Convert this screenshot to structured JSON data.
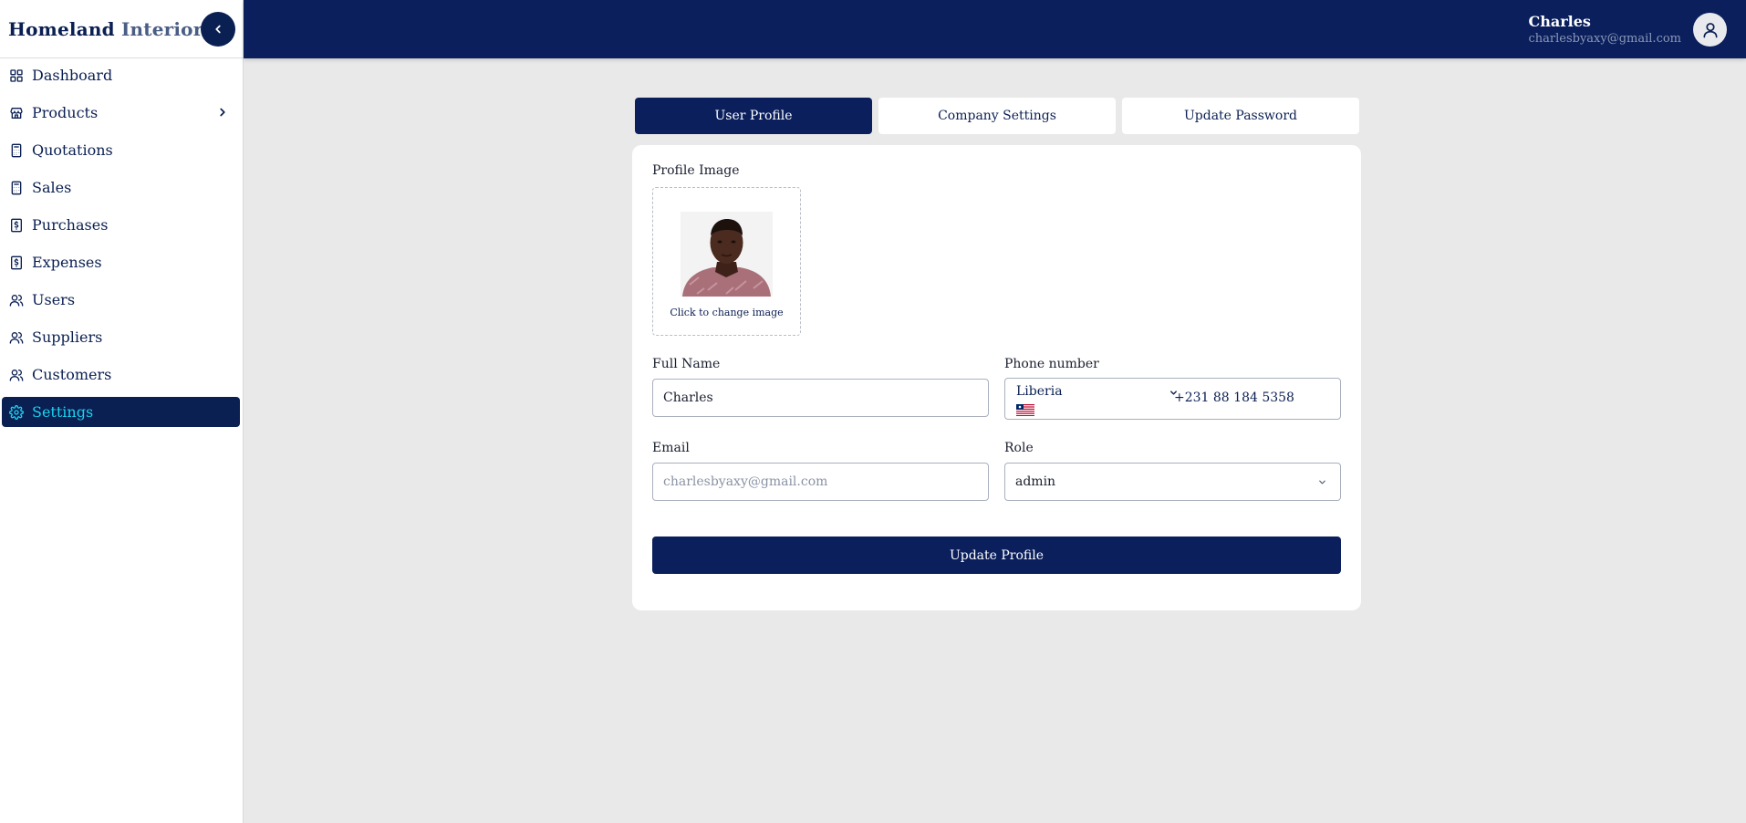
{
  "brand": {
    "name_part1": "Homeland",
    "name_part2": "Interiors"
  },
  "sidebar": {
    "items": [
      {
        "label": "Dashboard",
        "icon": "grid-icon"
      },
      {
        "label": "Products",
        "icon": "store-icon"
      },
      {
        "label": "Quotations",
        "icon": "calculator-icon"
      },
      {
        "label": "Sales",
        "icon": "calculator-icon"
      },
      {
        "label": "Purchases",
        "icon": "dollar-receipt-icon"
      },
      {
        "label": "Expenses",
        "icon": "dollar-receipt-icon"
      },
      {
        "label": "Users",
        "icon": "users-icon"
      },
      {
        "label": "Suppliers",
        "icon": "users-icon"
      },
      {
        "label": "Customers",
        "icon": "users-icon"
      },
      {
        "label": "Settings",
        "icon": "gear-icon",
        "active": true
      }
    ]
  },
  "header": {
    "user_name": "Charles",
    "user_email": "charlesbyaxy@gmail.com"
  },
  "tabs": [
    {
      "label": "User Profile",
      "active": true
    },
    {
      "label": "Company Settings"
    },
    {
      "label": "Update Password"
    }
  ],
  "form": {
    "profile_image_label": "Profile Image",
    "change_image_caption": "Click to change image",
    "full_name_label": "Full Name",
    "full_name_value": "Charles",
    "phone_label": "Phone number",
    "phone_country": "Liberia",
    "phone_value": "+231 88 184 5358",
    "email_label": "Email",
    "email_placeholder": "charlesbyaxy@gmail.com",
    "role_label": "Role",
    "role_value": "admin",
    "submit_label": "Update Profile"
  },
  "colors": {
    "primary": "#0a1f5c",
    "active_text": "#19d4f0",
    "background": "#e8e9e8"
  }
}
